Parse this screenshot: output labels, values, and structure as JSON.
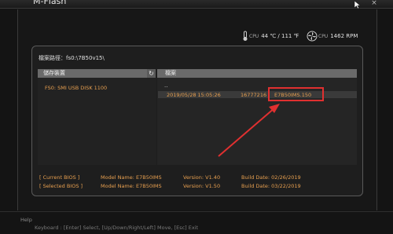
{
  "window": {
    "title": "M-Flash",
    "close_glyph": "×"
  },
  "sensors": {
    "cpu_temp_label": "CPU",
    "cpu_temp_value": "44 ℃ / 111 ℉",
    "cpu_fan_label": "CPU",
    "cpu_fan_value": "1462 RPM"
  },
  "path": {
    "text": "檔案路徑：fs0:\\7B50v15\\"
  },
  "columns": {
    "devices": "儲存裝置",
    "files": "檔案",
    "refresh_glyph": "↻"
  },
  "devices": [
    "FS0: SMI USB DISK 1100"
  ],
  "files": {
    "parent": "..",
    "rows": [
      {
        "date": "2019/05/28 15:05:26",
        "size": "16777216",
        "name": "E7B50IMS.150"
      }
    ]
  },
  "bios_info": [
    {
      "label": "[ Current BIOS  ]",
      "model": "Model Name: E7B50IMS",
      "version": "Version: V1.40",
      "date": "Build Date: 02/26/2019"
    },
    {
      "label": "[ Selected BIOS ]",
      "model": "Model Name: E7B50IMS",
      "version": "Version: V1.50",
      "date": "Build Date: 03/22/2019"
    }
  ],
  "help": {
    "title": "Help",
    "keys": "Keyboard :  [Enter] Select,   [Up/Down/Right/Left] Move,   [Esc] Exit"
  },
  "colors": {
    "accent_orange": "#e8a050",
    "highlight_red": "#e03030",
    "panel_border": "#5a5a5a",
    "header_bg": "#6a6a6a"
  }
}
